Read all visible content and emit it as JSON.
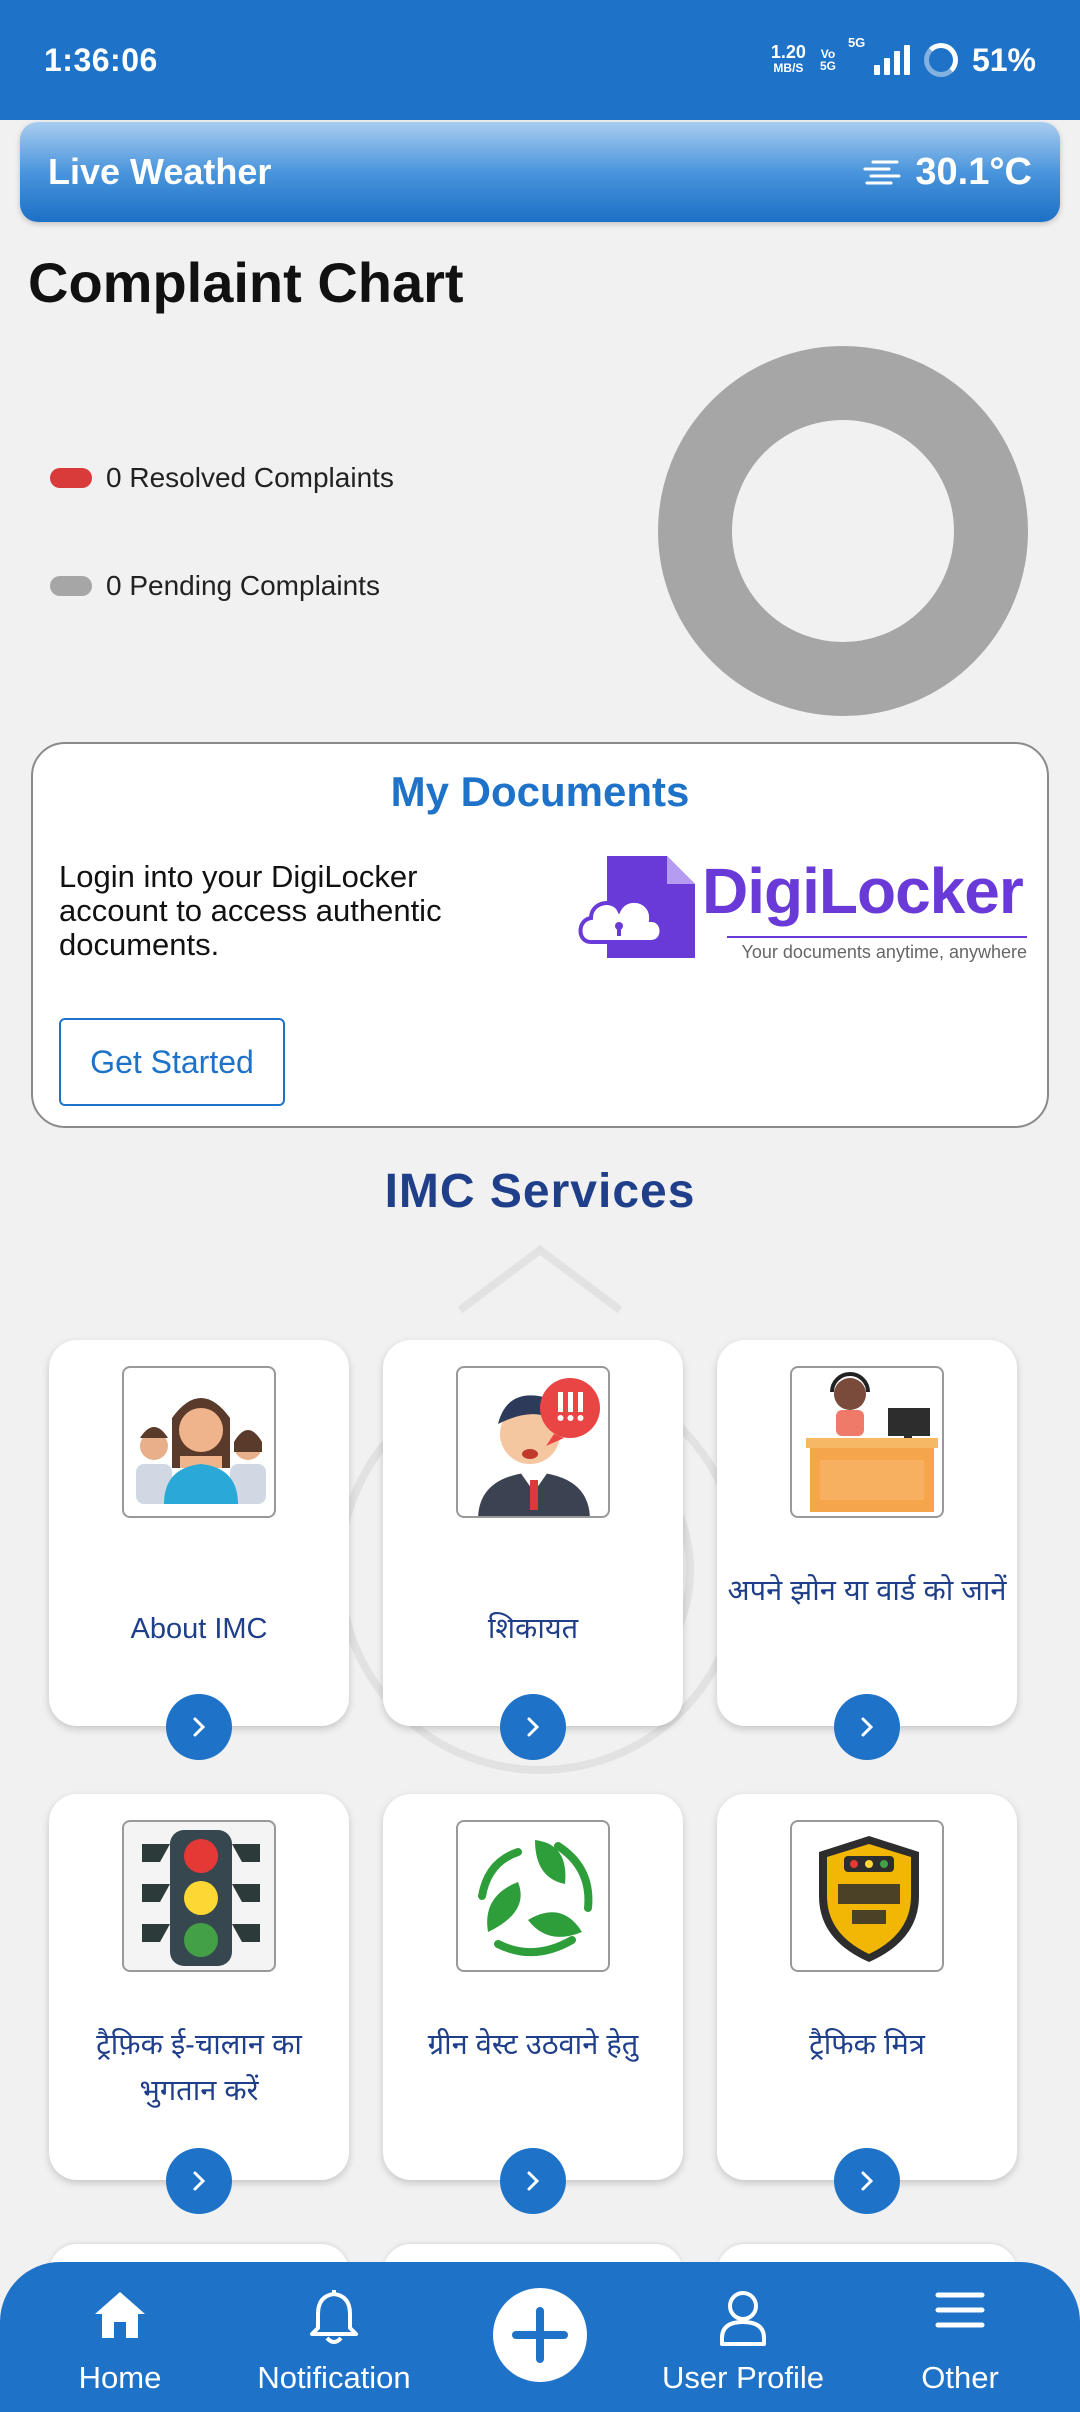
{
  "status_bar": {
    "time": "1:36:06",
    "net_speed_value": "1.20",
    "net_speed_unit": "MB/S",
    "volte_top": "Vo",
    "volte_bottom": "5G",
    "network": "5G",
    "battery": "51%"
  },
  "weather": {
    "title": "Live Weather",
    "icon": "haze-icon",
    "temperature": "30.1°C"
  },
  "complaint_chart": {
    "title": "Complaint Chart",
    "legend": [
      {
        "label": "0 Resolved Complaints",
        "color": "#d93a3a"
      },
      {
        "label": "0 Pending Complaints",
        "color": "#a6a6a6"
      }
    ],
    "chart_data": {
      "type": "pie",
      "categories": [
        "Resolved Complaints",
        "Pending Complaints"
      ],
      "values": [
        0,
        0
      ],
      "colors": [
        "#d93a3a",
        "#a6a6a6"
      ]
    }
  },
  "documents": {
    "title": "My Documents",
    "description": "Login into your DigiLocker account to access authentic documents.",
    "button": "Get Started",
    "logo_name": "DigiLocker",
    "logo_tagline": "Your documents anytime, anywhere"
  },
  "services": {
    "title": "IMC Services",
    "items": [
      {
        "label": "About IMC",
        "icon": "people-icon"
      },
      {
        "label": "शिकायत",
        "icon": "complaint-person-icon"
      },
      {
        "label": "अपने झोन या वार्ड को जानें",
        "icon": "help-desk-icon"
      },
      {
        "label": "ट्रैफ़िक ई-चालान का भुगतान करें",
        "icon": "traffic-light-icon"
      },
      {
        "label": "ग्रीन वेस्ट उठवाने हेतु",
        "icon": "recycle-leaf-icon"
      },
      {
        "label": "ट्रैफिक मित्र",
        "icon": "traffic-mitra-badge-icon"
      }
    ]
  },
  "bottom_nav": {
    "items": [
      {
        "label": "Home",
        "icon": "home-icon"
      },
      {
        "label": "Notification",
        "icon": "bell-icon"
      },
      {
        "label": "User Profile",
        "icon": "user-icon"
      },
      {
        "label": "Other",
        "icon": "menu-icon"
      }
    ],
    "add_icon": "plus-circle-icon"
  },
  "colors": {
    "primary": "#1e73c8",
    "service_text": "#1f3f8a",
    "digilocker": "#6a3ad8"
  }
}
